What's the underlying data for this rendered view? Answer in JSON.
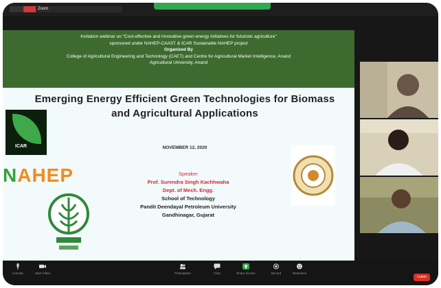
{
  "topbar": {
    "tab1_label": "Zoom",
    "tab2_label": "",
    "right_label": ""
  },
  "slide": {
    "header_lines": [
      "Invitation webinar on \"Cost-effective and innovative green energy initiatives for futuristic agriculture\"",
      "sponsored under NAHEP-CAAST & ICAR Sustainable NAHEP project",
      "Organized By",
      "College of Agricultural Engineering and Technology (CAET) and Centre for Agricultural Market Intelligence, Anand",
      "Agricultural University, Anand"
    ],
    "title": "Emerging Energy Efficient Green Technologies for Biomass and Agricultural Applications",
    "date": "NOVEMBER 12, 2020",
    "speaker_heading": "Speaker",
    "speaker_name": "Prof. Surendra Singh Kachhwaha",
    "speaker_dept": "Dept. of Mech. Engg.",
    "speaker_school": "School of Technology",
    "speaker_university": "Pandit Deendayal Petroleum University",
    "speaker_city": "Gandhinagar, Gujarat",
    "logo_icar_text": "ICAR",
    "logo_nahep_a": "N",
    "logo_nahep_b": "AHEP"
  },
  "participants": [
    {
      "name": ""
    },
    {
      "name": ""
    },
    {
      "name": ""
    }
  ],
  "toolbar": {
    "status_text": "",
    "buttons": [
      {
        "label": "Unmute",
        "icon": "microphone-icon"
      },
      {
        "label": "Start Video",
        "icon": "camera-icon"
      },
      {
        "label": "Participants",
        "icon": "participants-icon"
      },
      {
        "label": "Chat",
        "icon": "chat-icon"
      },
      {
        "label": "Share Screen",
        "icon": "share-screen-icon"
      },
      {
        "label": "Record",
        "icon": "record-icon"
      },
      {
        "label": "Reactions",
        "icon": "reactions-icon"
      }
    ],
    "leave_label": "Leave"
  },
  "colors": {
    "header_green": "#3d6b2f",
    "speaker_red": "#d9242c",
    "active_green": "#2fa84f",
    "leave_red": "#d93025"
  }
}
